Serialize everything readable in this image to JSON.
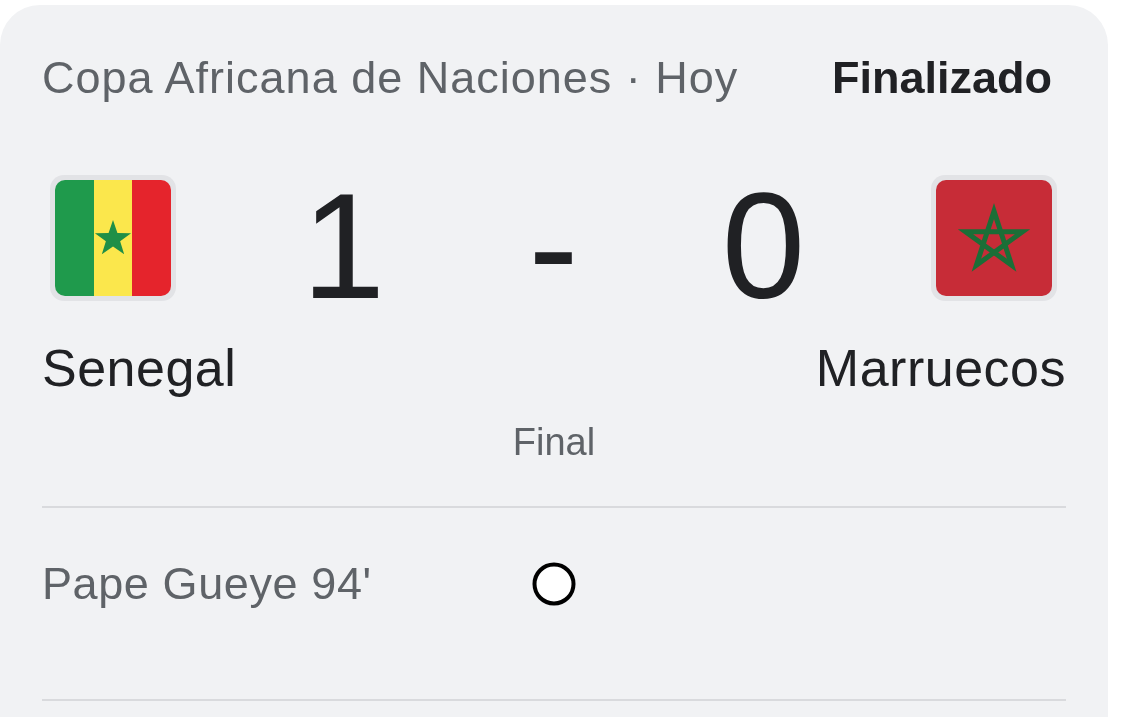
{
  "header": {
    "competition": "Copa Africana de Naciones · Hoy",
    "status": "Finalizado"
  },
  "teams": [
    {
      "name": "Senegal",
      "score": "1"
    },
    {
      "name": "Marruecos",
      "score": "0"
    }
  ],
  "score_separator": "-",
  "period": "Final",
  "events": [
    {
      "kind": "goal",
      "home_team": true,
      "text": "Pape Gueye 94'"
    }
  ]
}
